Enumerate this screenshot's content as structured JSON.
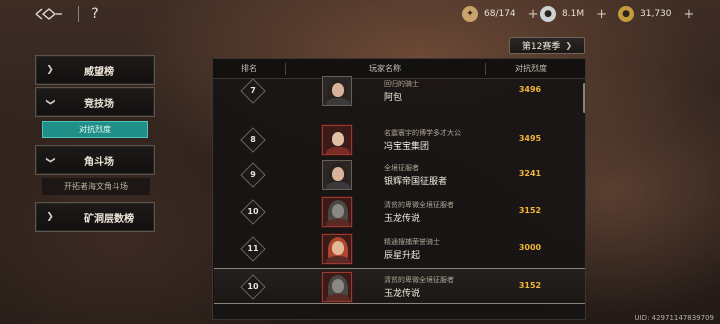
{
  "topbar": {
    "back_icon": "back-arrow-icon",
    "help_label": "?",
    "resources": [
      {
        "name": "stamina",
        "icon": "stamina-icon",
        "value": "68/174",
        "color": "#c9a36a"
      },
      {
        "name": "silver",
        "icon": "silver-coin-icon",
        "value": "8.1M",
        "color": "#cfd2d4"
      },
      {
        "name": "gold",
        "icon": "gold-coin-icon",
        "value": "31,730",
        "color": "#c59a3d"
      }
    ],
    "plus_label": "+"
  },
  "season": {
    "label": "第12赛季",
    "arrow": "❯"
  },
  "menu": {
    "items": [
      {
        "label": "威望榜",
        "chev": "❯"
      },
      {
        "label": "竞技场",
        "chev": "❯",
        "expanded": true
      },
      {
        "label": "角斗场",
        "chev": "❯",
        "expanded": true
      },
      {
        "label": "矿洞层数榜",
        "chev": "❯"
      }
    ],
    "sub_active": "对抗烈度",
    "sub_plain": "开拓者海文角斗场"
  },
  "table": {
    "headers": {
      "rank": "排名",
      "player": "玩家名称",
      "score": "对抗烈度"
    },
    "rows": [
      {
        "rank": "7",
        "title": "回归的骑士",
        "name": "阿包",
        "score": "3496",
        "hair": "#2a2220",
        "face": "#d8b39a",
        "body": "#3a3a3c",
        "framed": false
      },
      {
        "rank": "8",
        "title": "名震寰宇的博学多才大公",
        "name": "冯宝宝集团",
        "score": "3495",
        "hair": "#3a1d1a",
        "face": "#e0bfa5",
        "body": "#7a2c26",
        "framed": true
      },
      {
        "rank": "9",
        "title": "全境征服者",
        "name": "银辉帝国征服者",
        "score": "3241",
        "hair": "#2a2220",
        "face": "#d8b39a",
        "body": "#3a3a3c",
        "framed": false
      },
      {
        "rank": "10",
        "title": "清贫的卑微全境征服者",
        "name": "玉龙传说",
        "score": "3152",
        "hair": "#4a4744",
        "face": "#8a8784",
        "body": "#5a2a24",
        "framed": true
      },
      {
        "rank": "11",
        "title": "精通搜捕荣誉骑士",
        "name": "辰星升起",
        "score": "3000",
        "hair": "#b0452f",
        "face": "#e2b897",
        "body": "#5a2a24",
        "framed": true
      },
      {
        "rank": "10",
        "title": "清贫的卑微全境征服者",
        "name": "玉龙传说",
        "score": "3152",
        "hair": "#4a4744",
        "face": "#8a8784",
        "body": "#5a2a24",
        "framed": true,
        "selected": true
      }
    ]
  },
  "uid": "UID: 42971147839709"
}
